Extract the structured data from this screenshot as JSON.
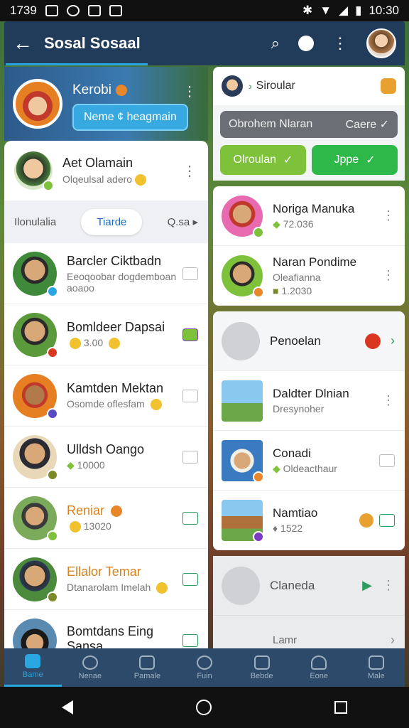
{
  "status_bar": {
    "time": "1739",
    "clock": "10:30"
  },
  "app_bar": {
    "title": "Sosal Sosaal"
  },
  "profile": {
    "name": "Kerobi",
    "button_label": "Neme ¢ heagmain"
  },
  "left_header": {
    "name": "Aet Olamain",
    "sub": "Olqeulsal adero"
  },
  "left_tabs": [
    "Ilonulalia",
    "Tiarde",
    "Q.sa"
  ],
  "left_list": [
    {
      "name": "Barcler Ciktbadn",
      "sub": "Eeoqoobar dogdemboan aoaoo"
    },
    {
      "name": "Bomldeer Dapsai",
      "sub": "3.00"
    },
    {
      "name": "Kamtden Mektan",
      "sub": "Osomde oflesfam"
    },
    {
      "name": "Ulldsh Oango",
      "sub": "10000"
    },
    {
      "name": "Reniar",
      "sub": "13020"
    },
    {
      "name": "Ellalor Temar",
      "sub": "Dtanarolam Imelah"
    },
    {
      "name": "Bomtdans Eing Sansa",
      "sub": ""
    }
  ],
  "right_header": {
    "title": "Siroular"
  },
  "right_search": {
    "text": "Obrohem Nlaran",
    "action": "Caere"
  },
  "right_buttons": [
    {
      "label": "Olroulan"
    },
    {
      "label": "Jppe"
    }
  ],
  "right_card1": [
    {
      "name": "Noriga Manuka",
      "sub": "72.036"
    },
    {
      "name": "Naran Pondime",
      "sub": "Oleafianna",
      "sub2": "1.2030"
    }
  ],
  "right_card2": [
    {
      "name": "Penoelan"
    },
    {
      "name": "Daldter Dlnian",
      "sub": "Dresynoher"
    },
    {
      "name": "Conadi",
      "sub": "Oldeacthaur"
    },
    {
      "name": "Namtiao",
      "sub": "1522"
    }
  ],
  "right_gray": [
    {
      "name": "Claneda"
    },
    {
      "name": "Lamr"
    }
  ],
  "bottom_nav": [
    "Bame",
    "Nenae",
    "Pamale",
    "Fuin",
    "Bebde",
    "Eone",
    "Male"
  ]
}
